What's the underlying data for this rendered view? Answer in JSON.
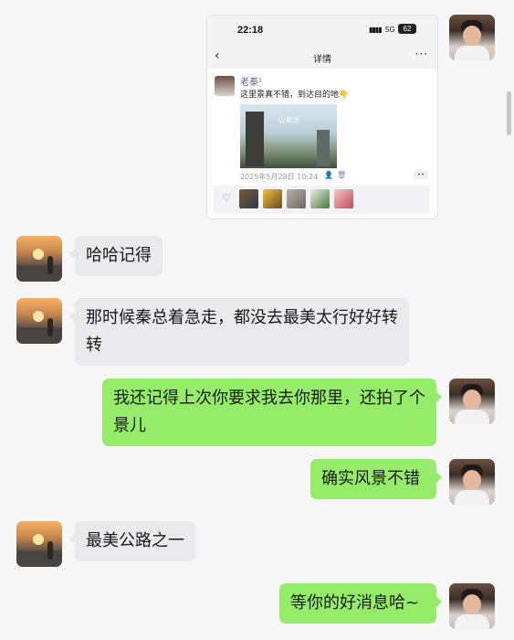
{
  "shared_screenshot": {
    "status_time": "22:18",
    "status_network": "5G",
    "status_battery": "62",
    "nav_back": "‹",
    "nav_title": "详情",
    "nav_more": "···",
    "post_author": "老秦¹",
    "post_text": "这里景真不错，到达目的地👇",
    "photo_caption": "山和乐",
    "post_timestamp": "2025年5月28日 10:24",
    "heart_icon": "♡"
  },
  "messages": [
    {
      "side": "left",
      "text": "哈哈记得"
    },
    {
      "side": "left",
      "text": "那时候秦总着急走，都没去最美太行好好转转"
    },
    {
      "side": "right",
      "text": "我还记得上次你要求我去你那里，还拍了个景儿"
    },
    {
      "side": "right",
      "text": "确实风景不错"
    },
    {
      "side": "left",
      "text": "最美公路之一"
    },
    {
      "side": "right",
      "text": "等你的好消息哈~"
    }
  ],
  "colors": {
    "incoming_bubble": "#eaeaec",
    "outgoing_bubble": "#95ec69",
    "background": "#f6f6f7",
    "link_blue": "#576b95"
  }
}
